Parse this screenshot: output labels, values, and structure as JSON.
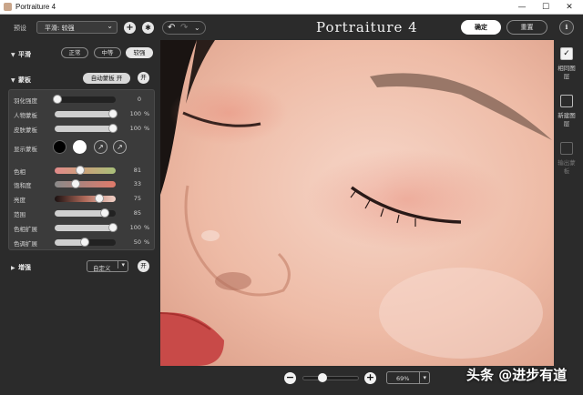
{
  "window": {
    "title": "Portraiture 4",
    "minimize": "—",
    "maximize": "☐",
    "close": "✕"
  },
  "toolbar": {
    "preset_label": "预设",
    "preset_value": "平滑: 较强",
    "add_icon": "plus-icon",
    "settings_icon": "gear-icon",
    "brand": "Portraiture 4",
    "ok_label": "确定",
    "reset_label": "重置",
    "info_label": "i"
  },
  "smoothing": {
    "label": "平滑",
    "options": [
      "正常",
      "中等",
      "较强"
    ],
    "selected": "较强"
  },
  "mask": {
    "label": "蒙板",
    "auto_button": "自动蒙板 开",
    "toggle": "开",
    "sliders_top": [
      {
        "label": "羽化强度",
        "value": "0",
        "unit": ""
      },
      {
        "label": "人物蒙板",
        "value": "100",
        "unit": "%"
      },
      {
        "label": "皮肤蒙板",
        "value": "100",
        "unit": "%"
      }
    ],
    "display_label": "显示蒙板",
    "display_colors": [
      "#000000",
      "#ffffff"
    ],
    "sliders_bottom": [
      {
        "label": "色相",
        "value": "81",
        "unit": ""
      },
      {
        "label": "饱和度",
        "value": "33",
        "unit": ""
      },
      {
        "label": "亮度",
        "value": "75",
        "unit": ""
      },
      {
        "label": "范围",
        "value": "85",
        "unit": ""
      },
      {
        "label": "色相扩展",
        "value": "100",
        "unit": "%"
      },
      {
        "label": "色调扩展",
        "value": "50",
        "unit": "%"
      }
    ]
  },
  "enhance": {
    "label": "增强",
    "select_value": "自定义",
    "toggle": "开"
  },
  "right_strip": {
    "items": [
      {
        "label": "相同图层",
        "checked": true
      },
      {
        "label": "新建图层",
        "checked": false
      },
      {
        "label": "输出蒙板",
        "checked": false
      }
    ]
  },
  "zoom": {
    "minus": "−",
    "plus": "+",
    "value": "69%",
    "level": 0.35
  },
  "watermark": "头条 @进步有道"
}
